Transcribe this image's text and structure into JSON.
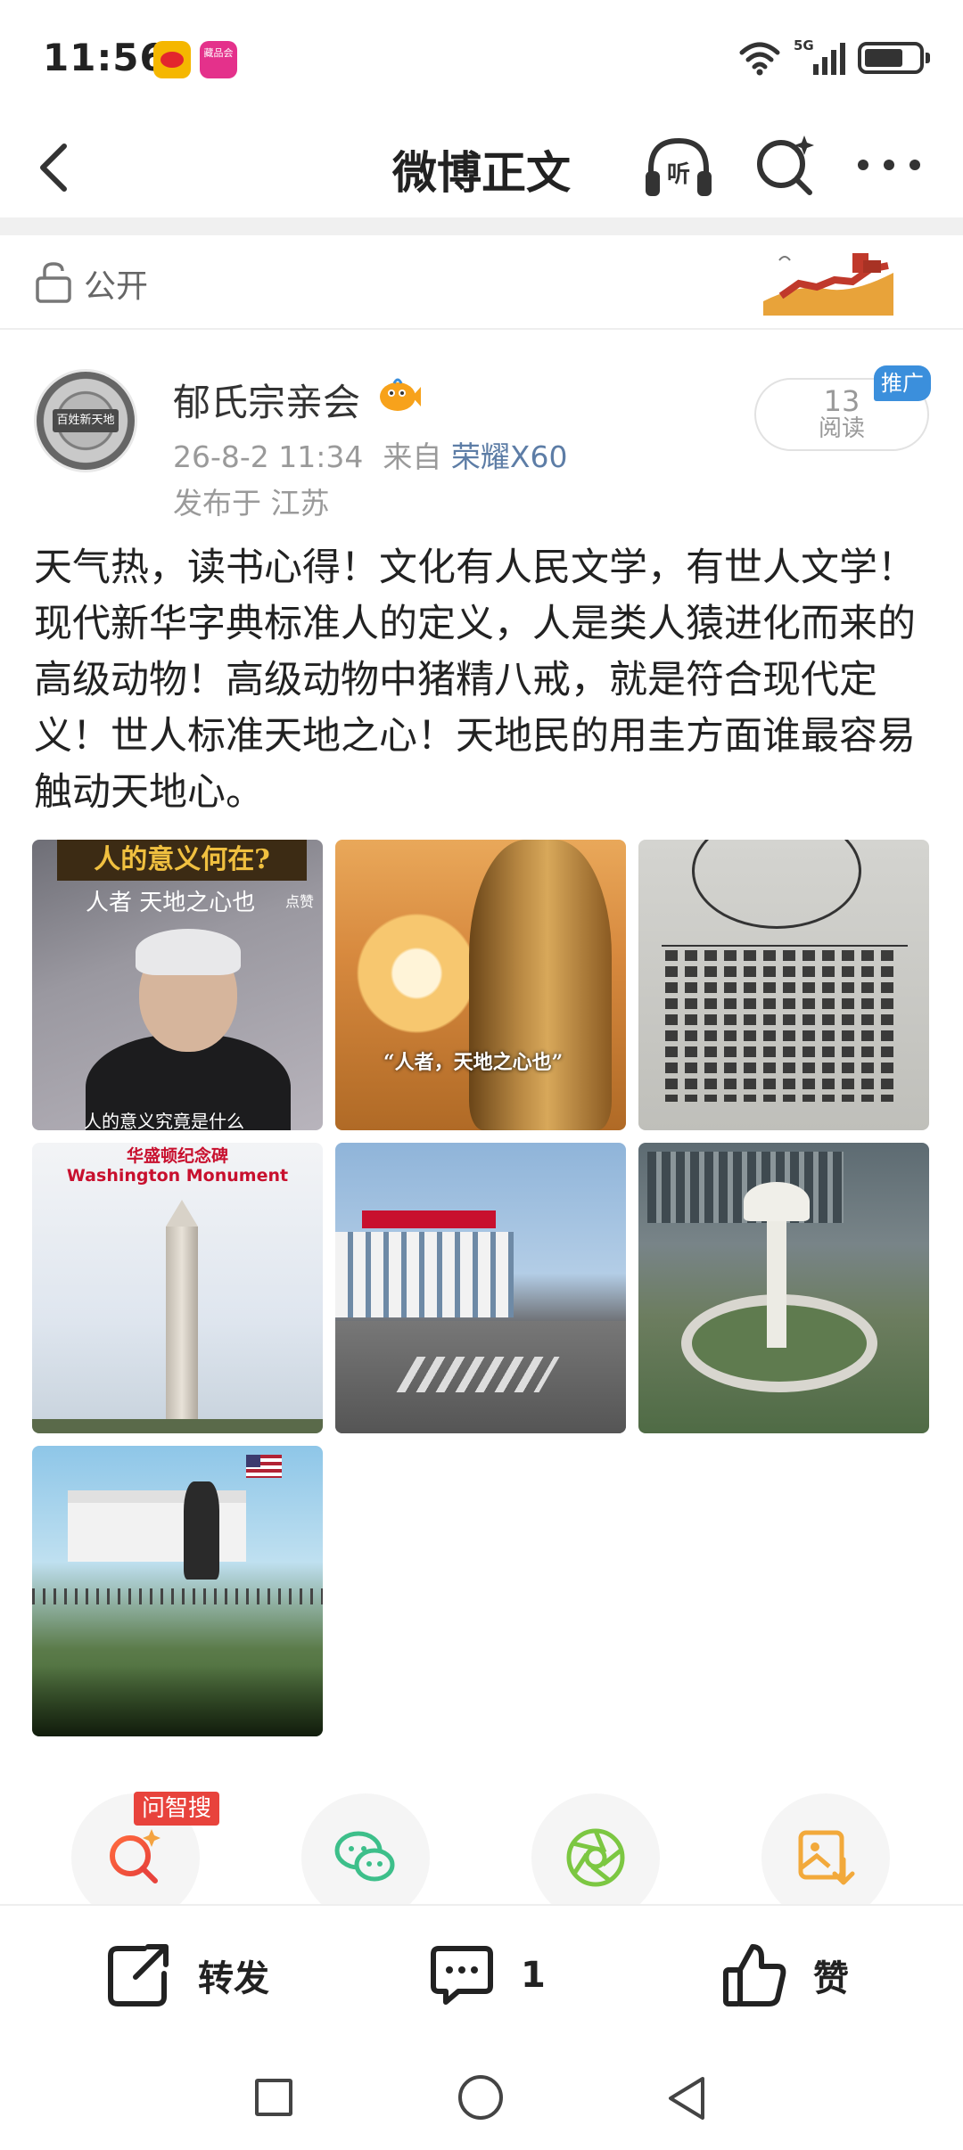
{
  "status_bar": {
    "time": "11:56",
    "app_icon_2_text": "藏品会",
    "network": "5G"
  },
  "nav": {
    "title": "微博正文"
  },
  "visibility": {
    "label": "公开"
  },
  "post": {
    "author": {
      "name": "郁氏宗亲会",
      "avatar_text": "百姓新天地"
    },
    "date_time": "26-8-2 11:34",
    "source_prefix": "来自",
    "device": "荣耀X60",
    "location": "发布于 江苏",
    "reads": {
      "count": "13",
      "label": "阅读"
    },
    "promo_badge": "推广",
    "text": "天气热，读书心得！文化有人民文学，有世人文学！现代新华字典标准人的定义，人是类人猿进化而来的高级动物！高级动物中猪精八戒，就是符合现代定义！世人标准天地之心！天地民的用圭方面谁最容易触动天地心。",
    "images": {
      "img1": {
        "title": "人的意义何在?",
        "subtitle": "人者 天地之心也",
        "tag": "点赞",
        "caption": "人的意义究竟是什么"
      },
      "img2": {
        "caption": "“人者，天地之心也”"
      },
      "img4": {
        "title_cn": "华盛顿纪念碑",
        "title_en": "Washington Monument"
      }
    }
  },
  "shortcuts": {
    "wzs_badge": "问智搜"
  },
  "actions": {
    "repost": "转发",
    "comment_count": "1",
    "like": "赞"
  },
  "colors": {
    "accent_blue": "#3b8fdc",
    "device_link": "#5d7da6",
    "badge_red": "#e8433c",
    "wechat_green": "#3dbf8a",
    "moments_green": "#7cc742",
    "gallery_orange": "#f2a93b"
  }
}
